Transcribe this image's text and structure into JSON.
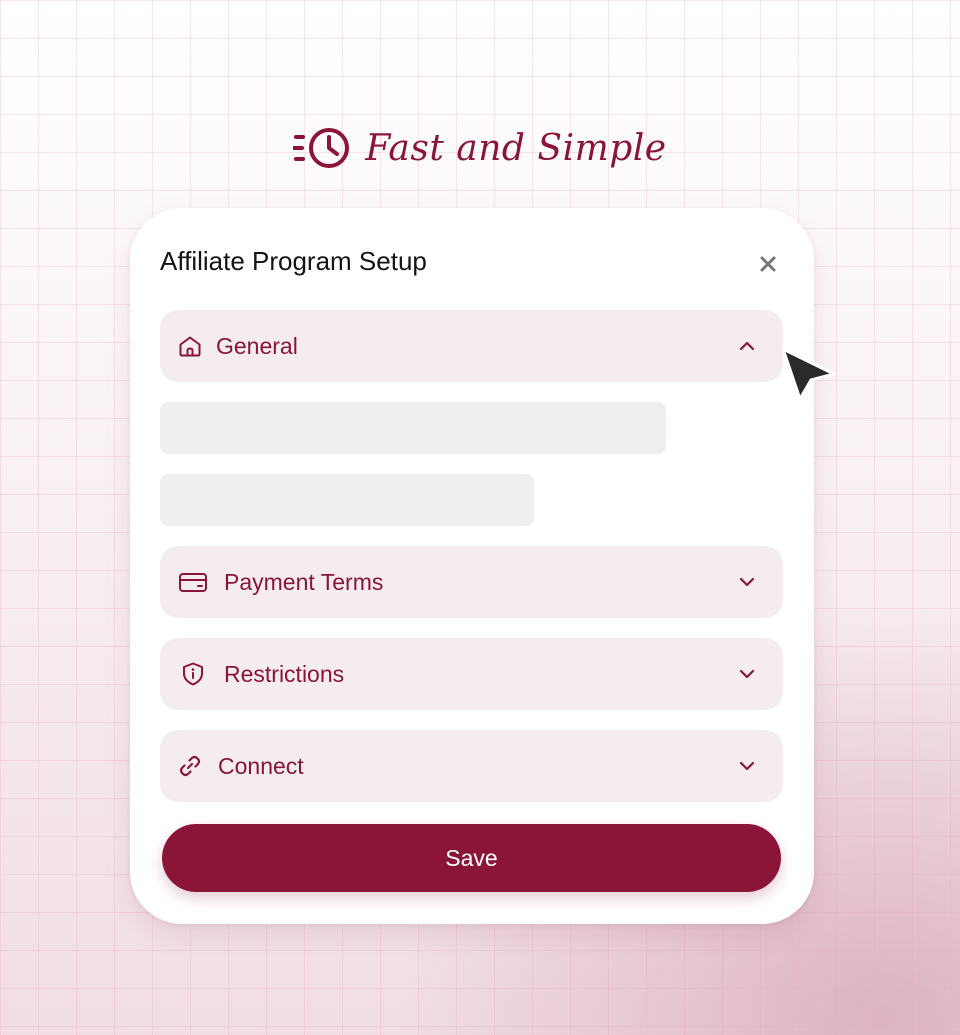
{
  "tagline": {
    "text": "Fast and Simple",
    "icon": "fast-clock-icon"
  },
  "dialog": {
    "title": "Affiliate Program Setup",
    "close_icon": "close-icon",
    "sections": [
      {
        "label": "General",
        "icon": "home-icon",
        "state": "expanded"
      },
      {
        "label": "Payment Terms",
        "icon": "credit-card-icon",
        "state": "collapsed"
      },
      {
        "label": "Restrictions",
        "icon": "shield-info-icon",
        "state": "collapsed"
      },
      {
        "label": "Connect",
        "icon": "link-icon",
        "state": "collapsed"
      }
    ],
    "save_label": "Save"
  },
  "colors": {
    "brand": "#8a1538",
    "section_bg": "#f4ecee",
    "placeholder": "#efefef",
    "title_text": "#141414"
  }
}
